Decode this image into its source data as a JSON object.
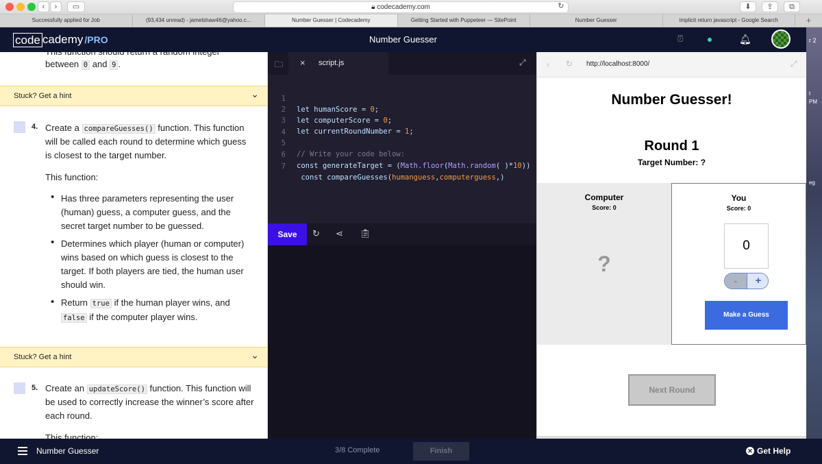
{
  "safari": {
    "url": "codecademy.com",
    "tabs": [
      {
        "label": "Successfully applied for Job"
      },
      {
        "label": "(93,434 unread) - jamelshaw46@yahoo.c..."
      },
      {
        "label": "Number Guesser | Codecademy"
      },
      {
        "label": "Getting Started with Puppeteer — SitePoint"
      },
      {
        "label": "Number Guesser"
      },
      {
        "label": "implicit return javascript - Google Search"
      }
    ],
    "add_tab": "+"
  },
  "header": {
    "logo_left": "code",
    "logo_right": "cademy",
    "logo_badge": "/PRO",
    "title": "Number Guesser"
  },
  "desktop_strip": {
    "text1": "r 2",
    "text2": "t",
    "text3": "PM",
    "text4": "eg"
  },
  "instructions": {
    "top_fragment": "This function should return a random integer",
    "top_line_pre": "between",
    "top_code_1": "0",
    "top_line_mid": "and",
    "top_code_2": "9",
    "top_line_end": ".",
    "hint_label_1": "Stuck? Get a hint",
    "task4": {
      "number": "4.",
      "pre": "Create a",
      "code": "compareGuesses()",
      "post": "function. This function",
      "line2": "will be called each round to determine which guess",
      "line3": "is closest to the target number.",
      "this_function": "This function:",
      "b1_l1": "Has three parameters representing the user",
      "b1_l2": "(human) guess, a computer guess, and the",
      "b1_l3": "secret target number to be guessed.",
      "b2_l1": "Determines which player (human or computer)",
      "b2_l2": "wins based on which guess is closest to the",
      "b2_l3": "target. If both players are tied, the human user",
      "b2_l4": "should win.",
      "b3_pre": "Return",
      "b3_code1": "true",
      "b3_post": "if the human player wins, and",
      "b3_code2": "false",
      "b3_post2": "if the computer player wins."
    },
    "hint_label_2": "Stuck? Get a hint",
    "task5": {
      "number": "5.",
      "pre": "Create an",
      "code": "updateScore()",
      "post": "function. This function will",
      "line2": "be used to correctly increase the winner’s score after",
      "line3": "each round.",
      "this_function": "This function:"
    }
  },
  "editor": {
    "file_tab": "script.js",
    "lines": [
      {
        "n": "1",
        "a": "let humanScore = ",
        "b": "0",
        "c": ";"
      },
      {
        "n": "2",
        "a": "let computerScore = ",
        "b": "0",
        "c": ";"
      },
      {
        "n": "3",
        "a": "let currentRoundNumber = ",
        "b": "1",
        "c": ";"
      },
      {
        "n": "4"
      },
      {
        "n": "5",
        "comment": "// Write your code below:"
      },
      {
        "n": "6",
        "a": "const generateTarget = (",
        "f1": "Math.floor",
        "a2": "(",
        "f2": "Math.random",
        "a3": "( )*",
        "b": "10",
        "c": "))"
      },
      {
        "n": "7",
        "a": " const compareGuesses(",
        "p": "humanguess",
        "a2": ",",
        "p2": "computerguess",
        "a3": ",)"
      }
    ],
    "save_label": "Save"
  },
  "preview": {
    "url": "http://localhost:8000/",
    "title": "Number Guesser!",
    "round": "Round 1",
    "target": "Target Number: ?",
    "computer": {
      "name": "Computer",
      "score": "Score: 0",
      "guess": "?"
    },
    "you": {
      "name": "You",
      "score": "Score: 0",
      "guess": "0",
      "minus": "-",
      "plus": "+"
    },
    "make_guess": "Make a Guess",
    "next_round": "Next Round"
  },
  "footer": {
    "lesson": "Number Guesser",
    "progress": "3/8 Complete",
    "finish": "Finish",
    "help": "Get Help"
  },
  "colors": {
    "navy": "#10162f",
    "save": "#3a10e5",
    "guess_button": "#3b6bdf",
    "hint_bar": "#fff3c4"
  }
}
